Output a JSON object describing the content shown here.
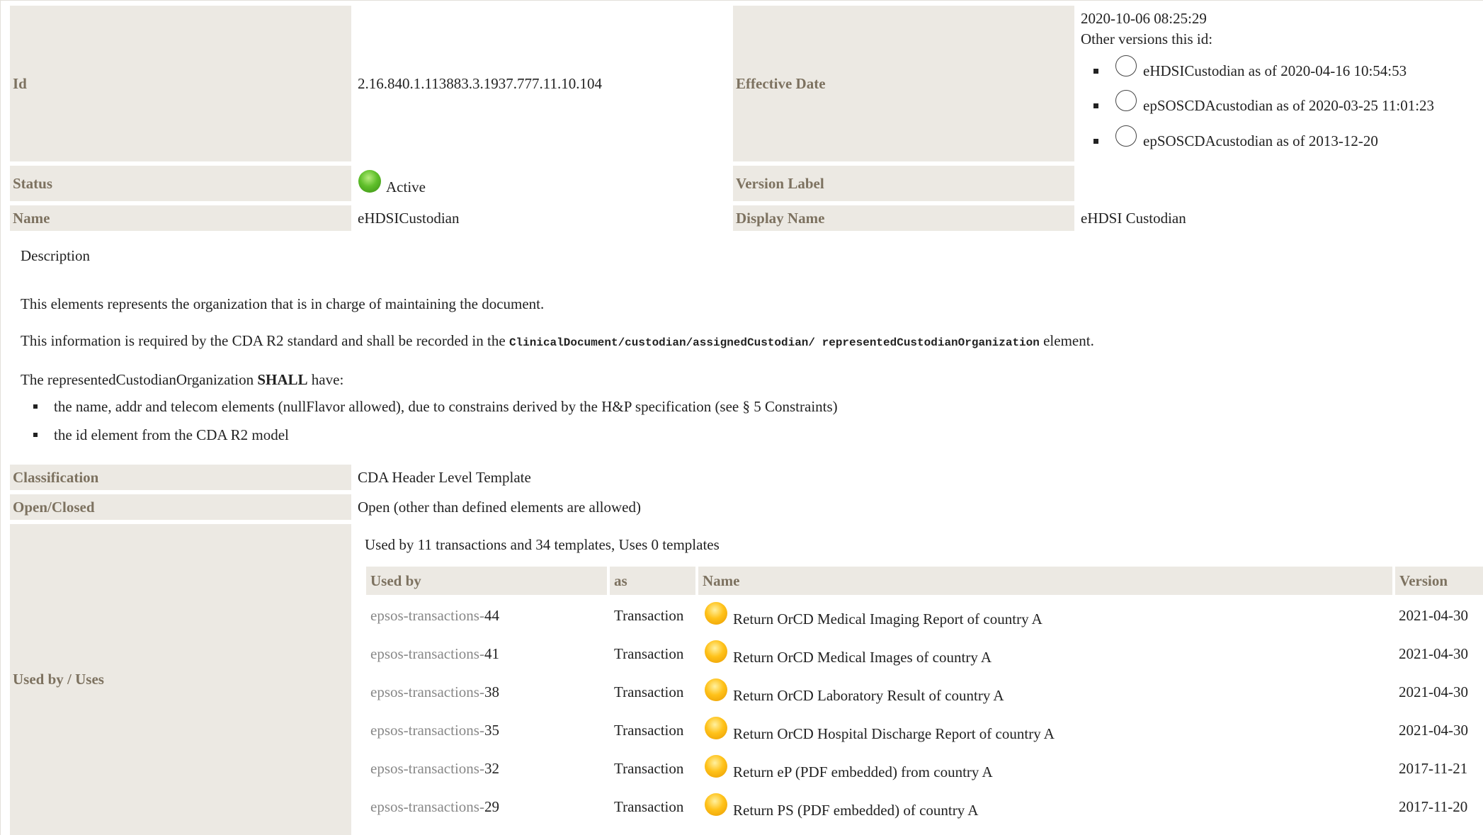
{
  "details": {
    "id_label": "Id",
    "id_value": "2.16.840.1.113883.3.1937.777.11.10.104",
    "effective_date_label": "Effective Date",
    "effective_date_value": "2020-10-06 08:25:29",
    "other_versions_label": "Other versions this id:",
    "other_versions": [
      {
        "text": "eHDSICustodian as of 2020-04-16 10:54:53"
      },
      {
        "text": "epSOSCDAcustodian as of 2020-03-25 11:01:23"
      },
      {
        "text": "epSOSCDAcustodian as of 2013-12-20"
      }
    ],
    "status_label": "Status",
    "status_value": "Active",
    "status_color": "#5fbf2a",
    "version_label_label": "Version Label",
    "version_label_value": "",
    "name_label": "Name",
    "name_value": "eHDSICustodian",
    "display_name_label": "Display Name",
    "display_name_value": "eHDSI Custodian"
  },
  "description": {
    "heading": "Description",
    "para1": "This elements represents the organization that is in charge of maintaining the document.",
    "para2_before": "This information is required by the CDA R2 standard and shall be recorded in the",
    "para2_code": "ClinicalDocument/custodian/assignedCustodian/ representedCustodianOrganization",
    "para2_after": "element.",
    "para3_before": "The representedCustodianOrganization",
    "para3_bold": "SHALL",
    "para3_after": "have:",
    "bullets": [
      "the name, addr and telecom elements (nullFlavor allowed), due to constrains derived by the H&P specification (see § 5 Constraints)",
      "the id element from the CDA R2 model"
    ]
  },
  "classification": {
    "label": "Classification",
    "value": "CDA Header Level Template"
  },
  "open_closed": {
    "label": "Open/Closed",
    "value": "Open (other than defined elements are allowed)"
  },
  "used_by": {
    "label": "Used by / Uses",
    "summary": "Used by 11 transactions and 34 templates, Uses 0 templates",
    "columns": [
      "Used by",
      "as",
      "Name",
      "Version"
    ],
    "rows": [
      {
        "prefix": "epsos-transactions-",
        "num": "44",
        "as": "Transaction",
        "name": "Return OrCD Medical Imaging Report of country A",
        "version": "2021-04-30"
      },
      {
        "prefix": "epsos-transactions-",
        "num": "41",
        "as": "Transaction",
        "name": "Return OrCD Medical Images of country A",
        "version": "2021-04-30"
      },
      {
        "prefix": "epsos-transactions-",
        "num": "38",
        "as": "Transaction",
        "name": "Return OrCD Laboratory Result of country A",
        "version": "2021-04-30"
      },
      {
        "prefix": "epsos-transactions-",
        "num": "35",
        "as": "Transaction",
        "name": "Return OrCD Hospital Discharge Report of country A",
        "version": "2021-04-30"
      },
      {
        "prefix": "epsos-transactions-",
        "num": "32",
        "as": "Transaction",
        "name": "Return eP (PDF embedded) from country A",
        "version": "2017-11-21"
      },
      {
        "prefix": "epsos-transactions-",
        "num": "29",
        "as": "Transaction",
        "name": "Return PS (PDF embedded) of country A",
        "version": "2017-11-20"
      }
    ],
    "status_color": "#ffc21a"
  }
}
